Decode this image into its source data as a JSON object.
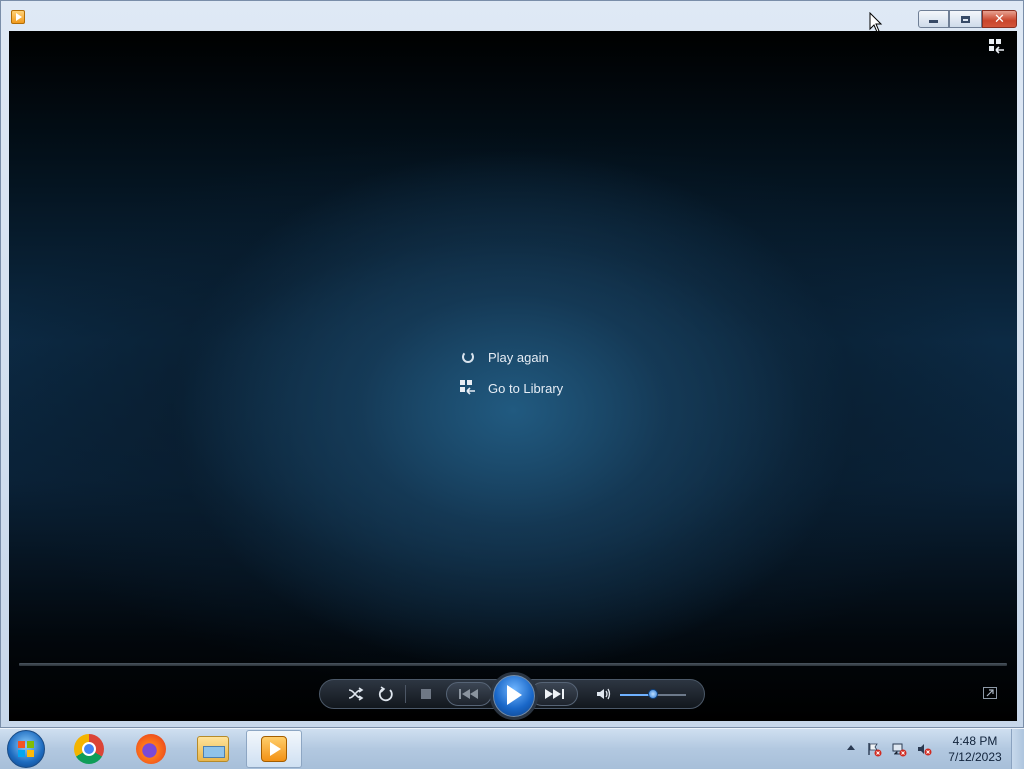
{
  "window": {
    "title": "",
    "buttons": {
      "minimize": "minimize",
      "maximize": "maximize",
      "close": "close"
    }
  },
  "player": {
    "menu": {
      "play_again": "Play again",
      "go_to_library": "Go to Library"
    },
    "controls": {
      "shuffle": "shuffle-icon",
      "repeat": "repeat-icon",
      "stop": "stop-icon",
      "previous": "previous-icon",
      "play": "play-icon",
      "next": "next-icon",
      "mute": "speaker-icon",
      "volume_level": 0.5
    }
  },
  "taskbar": {
    "apps": [
      "Google Chrome",
      "Firefox",
      "Windows Explorer",
      "Windows Media Player"
    ],
    "clock": {
      "time": "4:48 PM",
      "date": "7/12/2023"
    }
  }
}
